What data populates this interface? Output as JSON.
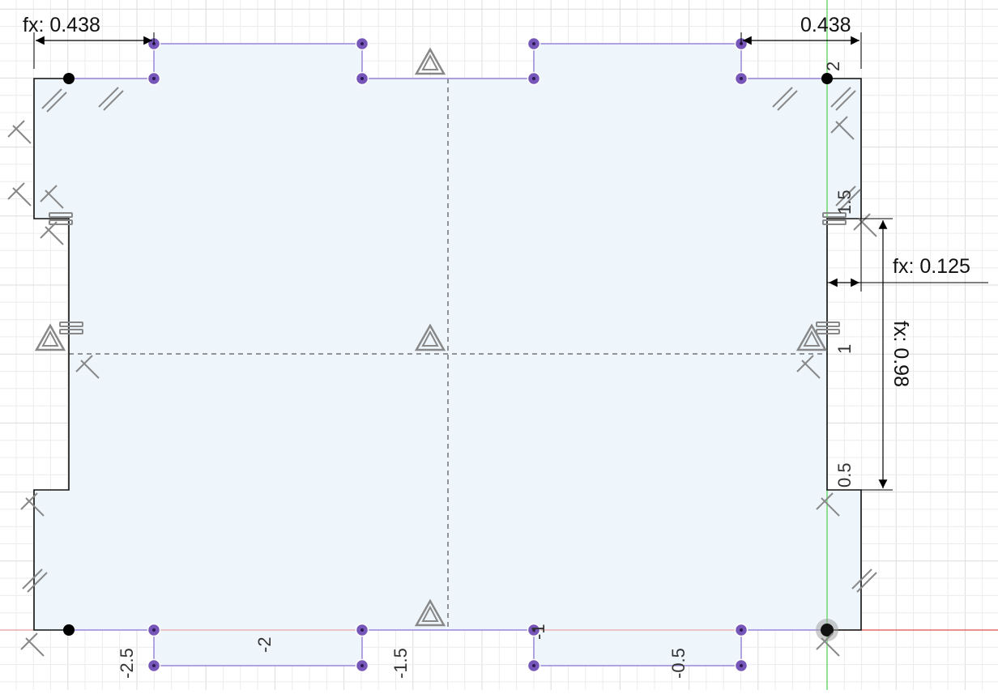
{
  "sketch": {
    "dimensions": {
      "top_left": "fx: 0.438",
      "top_right": "0.438",
      "right_notch": "fx: 0.125",
      "right_height": "fx: 0.98"
    },
    "ruler_y": {
      "v2": "2",
      "v1_5": "1.5",
      "v1": "1",
      "v0_5": "0.5"
    },
    "ruler_x": {
      "m2_5": "-2.5",
      "m2": "-2",
      "m1_5": "-1.5",
      "m1": "-1",
      "m0_5": "-0.5"
    },
    "colors": {
      "fill": "#eef6fc",
      "grid_major": "#dcdcdc",
      "grid_minor": "#ececec",
      "outline": "#111111",
      "construction": "#9a86d8",
      "point": "#7656b8",
      "x_axis": "#e0504a",
      "y_axis": "#4ccf4c",
      "constraint": "#888888"
    }
  }
}
